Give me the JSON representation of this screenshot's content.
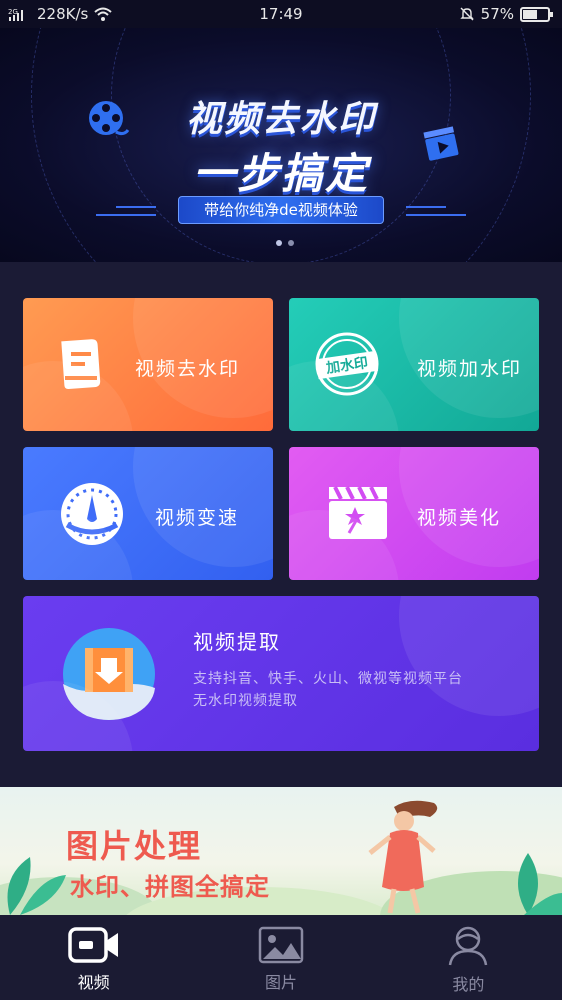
{
  "status_bar": {
    "signal_text": "2G",
    "speed": "228K/s",
    "time": "17:49",
    "battery": "57%",
    "battery_level": 0.57
  },
  "banner": {
    "title_line1": "视频去水印",
    "title_line2": "一步搞定",
    "pill": "带给你纯净de视频体验",
    "page_count": 2,
    "active_page": 0
  },
  "features": {
    "remove_watermark": {
      "label": "视频去水印",
      "icon": "document-icon"
    },
    "add_watermark": {
      "label": "视频加水印",
      "icon": "stamp-icon",
      "stamp_text": "加水印"
    },
    "speed": {
      "label": "视频变速",
      "icon": "speedometer-icon"
    },
    "beautify": {
      "label": "视频美化",
      "icon": "clapperboard-star-icon"
    },
    "extract": {
      "title": "视频提取",
      "desc_line1": "支持抖音、快手、火山、微视等视频平台",
      "desc_line2": "无水印视频提取",
      "icon": "film-download-icon"
    }
  },
  "promo": {
    "line1": "图片处理",
    "line2": "水印、拼图全搞定"
  },
  "tabs": [
    {
      "label": "视频",
      "icon": "video-camera-icon",
      "active": true
    },
    {
      "label": "图片",
      "icon": "image-icon",
      "active": false
    },
    {
      "label": "我的",
      "icon": "user-icon",
      "active": false
    }
  ],
  "colors": {
    "background": "#1b1b35",
    "accent_blue": "#2f6ff0",
    "card_remove": "#ff7d45",
    "card_add": "#1ab8a4",
    "card_speed": "#3f6cf8",
    "card_beauty": "#d24cf2",
    "card_extract": "#6234e8",
    "promo_text": "#ee5a4f"
  }
}
